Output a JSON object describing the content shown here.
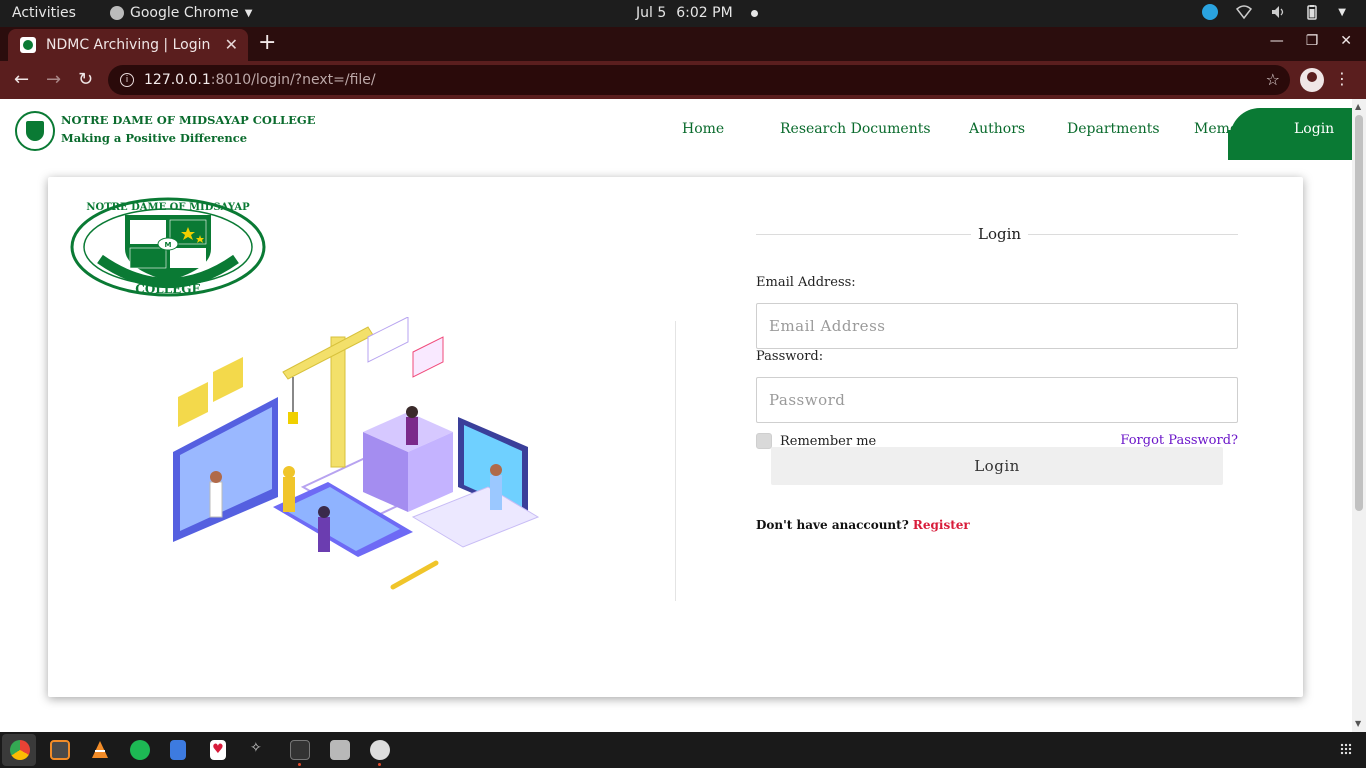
{
  "topbar": {
    "activities": "Activities",
    "app_name": "Google Chrome",
    "date": "Jul 5",
    "time": "6:02 PM"
  },
  "browser": {
    "tab_title": "NDMC Archiving | Login",
    "url_host": "127.0.0.1",
    "url_rest": ":8010/login/?next=/file/"
  },
  "site": {
    "brand_line1": "NOTRE DAME OF MIDSAYAP COLLEGE",
    "brand_line2": "Making a Positive Difference",
    "nav": {
      "home": "Home",
      "research": "Research Documents",
      "authors": "Authors",
      "departments": "Departments",
      "memo": "Memo",
      "login": "Login"
    }
  },
  "seal": {
    "top_text": "NOTRE DAME OF MIDSAYAP",
    "bottom_text": "COLLEGE"
  },
  "form": {
    "heading": "Login",
    "email_label": "Email Address:",
    "email_placeholder": "Email Address",
    "password_label": "Password:",
    "password_placeholder": "Password",
    "remember_label": "Remember me",
    "forgot_label": "Forgot Password?",
    "submit_label": "Login",
    "register_prompt": "Don't have anaccount?",
    "register_link": "Register"
  },
  "colors": {
    "brand_green": "#0a7a34",
    "link_purple": "#6b16c9",
    "register_red": "#d81b3a",
    "chrome_theme": "#5a1e1e"
  },
  "dock_icons": [
    "chrome-icon",
    "sublime-icon",
    "vlc-icon",
    "spotify-icon",
    "text-editor-icon",
    "heart-app-icon",
    "bug-icon",
    "terminal-icon",
    "files-icon",
    "software-icon"
  ]
}
